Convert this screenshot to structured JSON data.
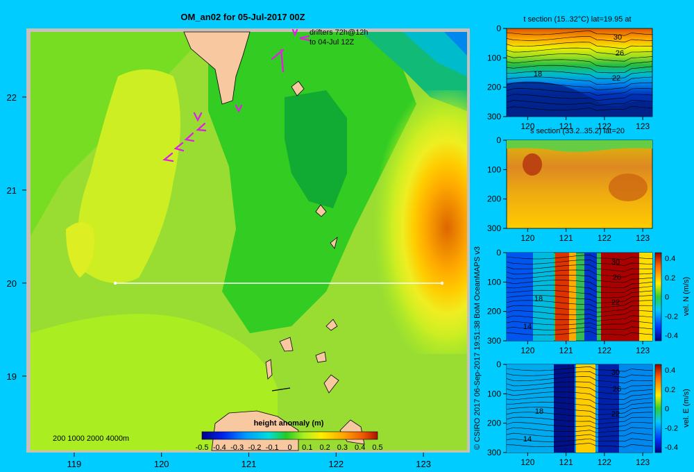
{
  "colors": {
    "background": "#00ccff",
    "land": "#f8c8a0",
    "land_shadow": "#c0a890",
    "drifter": "#dd22dd",
    "section_line": "#ffffff",
    "frame": "#c8c0b8"
  },
  "map": {
    "title": "OM_an02 for 05-Jul-2017 00Z",
    "drifters_line1": "drifters 72h@12h",
    "drifters_line2": "to 04-Jul 12Z",
    "depth_legend": "200 1000 2000 4000m",
    "colorbar_title": "height anomaly (m)",
    "colorbar_ticks": [
      "-0.5",
      "-0.4",
      "-0.3",
      "-0.2",
      "-0.1",
      "0",
      "0.1",
      "0.2",
      "0.3",
      "0.4",
      "0.5"
    ],
    "credit": "© CSIRO 2017   06-Sep-2017 19:51:38 BoM OceanMAPS v3"
  },
  "chart_data": [
    {
      "type": "heatmap",
      "name": "height anomaly map",
      "x_ticks": [
        119,
        120,
        121,
        122,
        123
      ],
      "y_ticks": [
        19,
        20,
        21,
        22
      ],
      "xlim": [
        118.5,
        123.5
      ],
      "ylim": [
        18.2,
        22.7
      ],
      "colorbar_range": [
        -0.5,
        0.5
      ],
      "section_line": {
        "lon": [
          119.5,
          123.2
        ],
        "lat": [
          20,
          20
        ]
      }
    },
    {
      "type": "heatmap",
      "title": "t section (15..32°C) lat=19.95 at",
      "x_ticks": [
        120,
        121,
        122,
        123
      ],
      "y_ticks": [
        0,
        100,
        200,
        300
      ],
      "contour_labels": [
        "30",
        "26",
        "18",
        "22"
      ]
    },
    {
      "type": "heatmap",
      "title": "s section (33.2..35.2) lat=20",
      "x_ticks": [
        120,
        121,
        122,
        123
      ],
      "y_ticks": [
        0,
        100,
        200,
        300
      ]
    },
    {
      "type": "heatmap",
      "colorbar_label": "vel. N (m/s)",
      "colorbar_ticks": [
        "0.4",
        "0.2",
        "0",
        "-0.2",
        "-0.4"
      ],
      "x_ticks": [
        120,
        121,
        122,
        123
      ],
      "y_ticks": [
        0,
        100,
        200,
        300
      ],
      "contour_labels": [
        "30",
        "26",
        "18",
        "22",
        "14"
      ]
    },
    {
      "type": "heatmap",
      "colorbar_label": "vel. E (m/s)",
      "colorbar_ticks": [
        "0.4",
        "0.2",
        "0",
        "-0.2",
        "-0.4"
      ],
      "x_ticks": [
        120,
        121,
        122,
        123
      ],
      "y_ticks": [
        0,
        100,
        200,
        300
      ],
      "contour_labels": [
        "30",
        "26",
        "18",
        "22",
        "14"
      ]
    }
  ]
}
